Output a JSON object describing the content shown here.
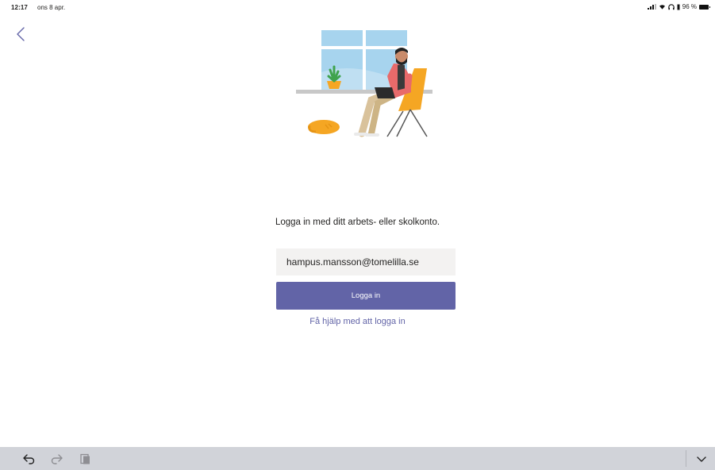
{
  "status_bar": {
    "time": "12:17",
    "date": "ons 8 apr.",
    "battery": "96 %"
  },
  "nav": {
    "back_icon": "chevron-left-icon"
  },
  "illustration": {
    "icon": "person-working-at-window-illustration"
  },
  "login": {
    "prompt": "Logga in med ditt arbets- eller skolkonto.",
    "email_value": "hampus.mansson@tomelilla.se",
    "button_label": "Logga in",
    "help_link": "Få hjälp med att logga in"
  },
  "keyboard_bar": {
    "icons": [
      "undo-icon",
      "redo-icon",
      "paste-icon",
      "chevron-down-icon"
    ]
  },
  "colors": {
    "accent": "#6264a7",
    "field_bg": "#f3f2f1",
    "keyboard_bar": "#d1d3d9"
  }
}
